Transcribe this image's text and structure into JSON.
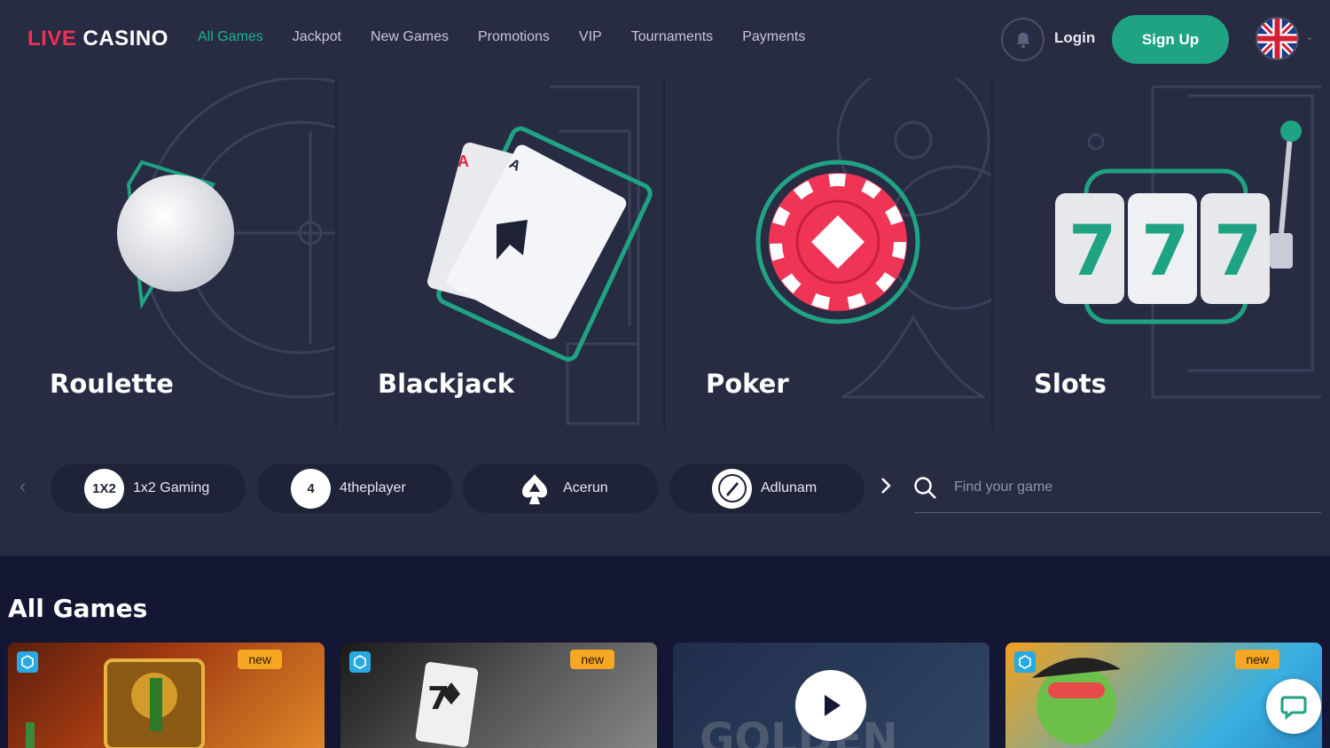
{
  "header": {
    "logo_live": "LIVE",
    "logo_casino": "CASINO",
    "nav": [
      "All Games",
      "Jackpot",
      "New Games",
      "Promotions",
      "VIP",
      "Tournaments",
      "Payments"
    ],
    "login": "Login",
    "signup": "Sign Up",
    "language_icon": "uk-flag-icon"
  },
  "categories": [
    {
      "label": "Roulette",
      "icon": "roulette-ball-icon"
    },
    {
      "label": "Blackjack",
      "icon": "cards-icon"
    },
    {
      "label": "Poker",
      "icon": "poker-chip-icon"
    },
    {
      "label": "Slots",
      "icon": "slot-machine-icon"
    }
  ],
  "providers": [
    {
      "name": "1x2 Gaming",
      "logo_text": "1X2"
    },
    {
      "name": "4theplayer",
      "logo_text": "4"
    },
    {
      "name": "Acerun",
      "logo_text": ""
    },
    {
      "name": "Adlunam",
      "logo_text": ""
    }
  ],
  "search": {
    "placeholder": "Find your game"
  },
  "games_section": {
    "title": "All Games",
    "games": [
      {
        "badge": "new",
        "colors": [
          "#a13a12",
          "#e08a2a"
        ]
      },
      {
        "badge": "new",
        "colors": [
          "#2a2a2a",
          "#777777"
        ]
      },
      {
        "badge": "",
        "colors": [
          "#3a5a88",
          "#5b7fae"
        ]
      },
      {
        "badge": "new",
        "colors": [
          "#f0a020",
          "#2ab0e0"
        ]
      }
    ]
  },
  "colors": {
    "accent": "#1fa383",
    "logo_red": "#ee2f58",
    "badge_new": "#f5a623"
  }
}
